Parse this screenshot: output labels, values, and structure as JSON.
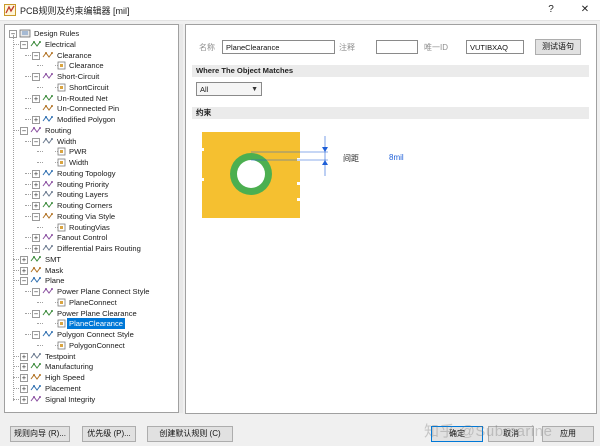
{
  "window": {
    "title": "PCB规则及约束编辑器 [mil]",
    "help_label": "?",
    "close_label": "✕",
    "icon": "pcb-app-icon"
  },
  "tree": {
    "items": [
      {
        "label": "Design Rules",
        "level": 0,
        "expander": "minus",
        "icon": "folder-rules-icon"
      },
      {
        "label": "Electrical",
        "level": 1,
        "expander": "minus",
        "icon": "electrical-icon"
      },
      {
        "label": "Clearance",
        "level": 2,
        "expander": "minus",
        "icon": "clearance-icon"
      },
      {
        "label": "Clearance",
        "level": 3,
        "expander": "none",
        "icon": "rule-icon"
      },
      {
        "label": "Short-Circuit",
        "level": 2,
        "expander": "minus",
        "icon": "short-circuit-icon"
      },
      {
        "label": "ShortCircuit",
        "level": 3,
        "expander": "none",
        "icon": "rule-icon"
      },
      {
        "label": "Un-Routed Net",
        "level": 2,
        "expander": "plus",
        "icon": "unrouted-net-icon"
      },
      {
        "label": "Un-Connected Pin",
        "level": 2,
        "expander": "none",
        "icon": "unconnected-pin-icon"
      },
      {
        "label": "Modified Polygon",
        "level": 2,
        "expander": "plus",
        "icon": "modified-polygon-icon"
      },
      {
        "label": "Routing",
        "level": 1,
        "expander": "minus",
        "icon": "routing-icon"
      },
      {
        "label": "Width",
        "level": 2,
        "expander": "minus",
        "icon": "width-icon"
      },
      {
        "label": "PWR",
        "level": 3,
        "expander": "none",
        "icon": "rule-icon"
      },
      {
        "label": "Width",
        "level": 3,
        "expander": "none",
        "icon": "rule-icon"
      },
      {
        "label": "Routing Topology",
        "level": 2,
        "expander": "plus",
        "icon": "routing-topology-icon"
      },
      {
        "label": "Routing Priority",
        "level": 2,
        "expander": "plus",
        "icon": "routing-priority-icon"
      },
      {
        "label": "Routing Layers",
        "level": 2,
        "expander": "plus",
        "icon": "routing-layers-icon"
      },
      {
        "label": "Routing Corners",
        "level": 2,
        "expander": "plus",
        "icon": "routing-corners-icon"
      },
      {
        "label": "Routing Via Style",
        "level": 2,
        "expander": "minus",
        "icon": "routing-via-style-icon"
      },
      {
        "label": "RoutingVias",
        "level": 3,
        "expander": "none",
        "icon": "rule-icon"
      },
      {
        "label": "Fanout Control",
        "level": 2,
        "expander": "plus",
        "icon": "fanout-control-icon"
      },
      {
        "label": "Differential Pairs Routing",
        "level": 2,
        "expander": "plus",
        "icon": "differential-pairs-icon"
      },
      {
        "label": "SMT",
        "level": 1,
        "expander": "plus",
        "icon": "smt-icon"
      },
      {
        "label": "Mask",
        "level": 1,
        "expander": "plus",
        "icon": "mask-icon"
      },
      {
        "label": "Plane",
        "level": 1,
        "expander": "minus",
        "icon": "plane-icon"
      },
      {
        "label": "Power Plane Connect Style",
        "level": 2,
        "expander": "minus",
        "icon": "plane-connect-style-icon"
      },
      {
        "label": "PlaneConnect",
        "level": 3,
        "expander": "none",
        "icon": "rule-icon"
      },
      {
        "label": "Power Plane Clearance",
        "level": 2,
        "expander": "minus",
        "icon": "plane-clearance-icon"
      },
      {
        "label": "PlaneClearance",
        "level": 3,
        "expander": "none",
        "icon": "rule-icon",
        "selected": true
      },
      {
        "label": "Polygon Connect Style",
        "level": 2,
        "expander": "minus",
        "icon": "polygon-connect-style-icon"
      },
      {
        "label": "PolygonConnect",
        "level": 3,
        "expander": "none",
        "icon": "rule-icon"
      },
      {
        "label": "Testpoint",
        "level": 1,
        "expander": "plus",
        "icon": "testpoint-icon"
      },
      {
        "label": "Manufacturing",
        "level": 1,
        "expander": "plus",
        "icon": "manufacturing-icon"
      },
      {
        "label": "High Speed",
        "level": 1,
        "expander": "plus",
        "icon": "high-speed-icon"
      },
      {
        "label": "Placement",
        "level": 1,
        "expander": "plus",
        "icon": "placement-icon"
      },
      {
        "label": "Signal Integrity",
        "level": 1,
        "expander": "plus",
        "icon": "signal-integrity-icon"
      }
    ]
  },
  "rule": {
    "name_label": "名称",
    "name_value": "PlaneClearance",
    "comment_label": "注释",
    "comment_value": "",
    "uid_label": "唯一ID",
    "uid_value": "VUTIBXAQ",
    "test_button": "测试语句"
  },
  "scope": {
    "header": "Where The Object Matches",
    "selected_option": "All"
  },
  "constraints": {
    "header": "约束",
    "gap_label": "间距",
    "gap_value": "8mil",
    "colors": {
      "board": "#f5c030",
      "ring": "#4caf50",
      "hole": "#ffffff"
    }
  },
  "footer": {
    "rule_wizard": "规则向导 (R)...",
    "priorities": "优先级 (P)...",
    "create_default": "创建默认规则 (C)",
    "ok": "确定",
    "cancel": "取消",
    "apply": "应用"
  },
  "watermark": "知乎 @Submarine"
}
